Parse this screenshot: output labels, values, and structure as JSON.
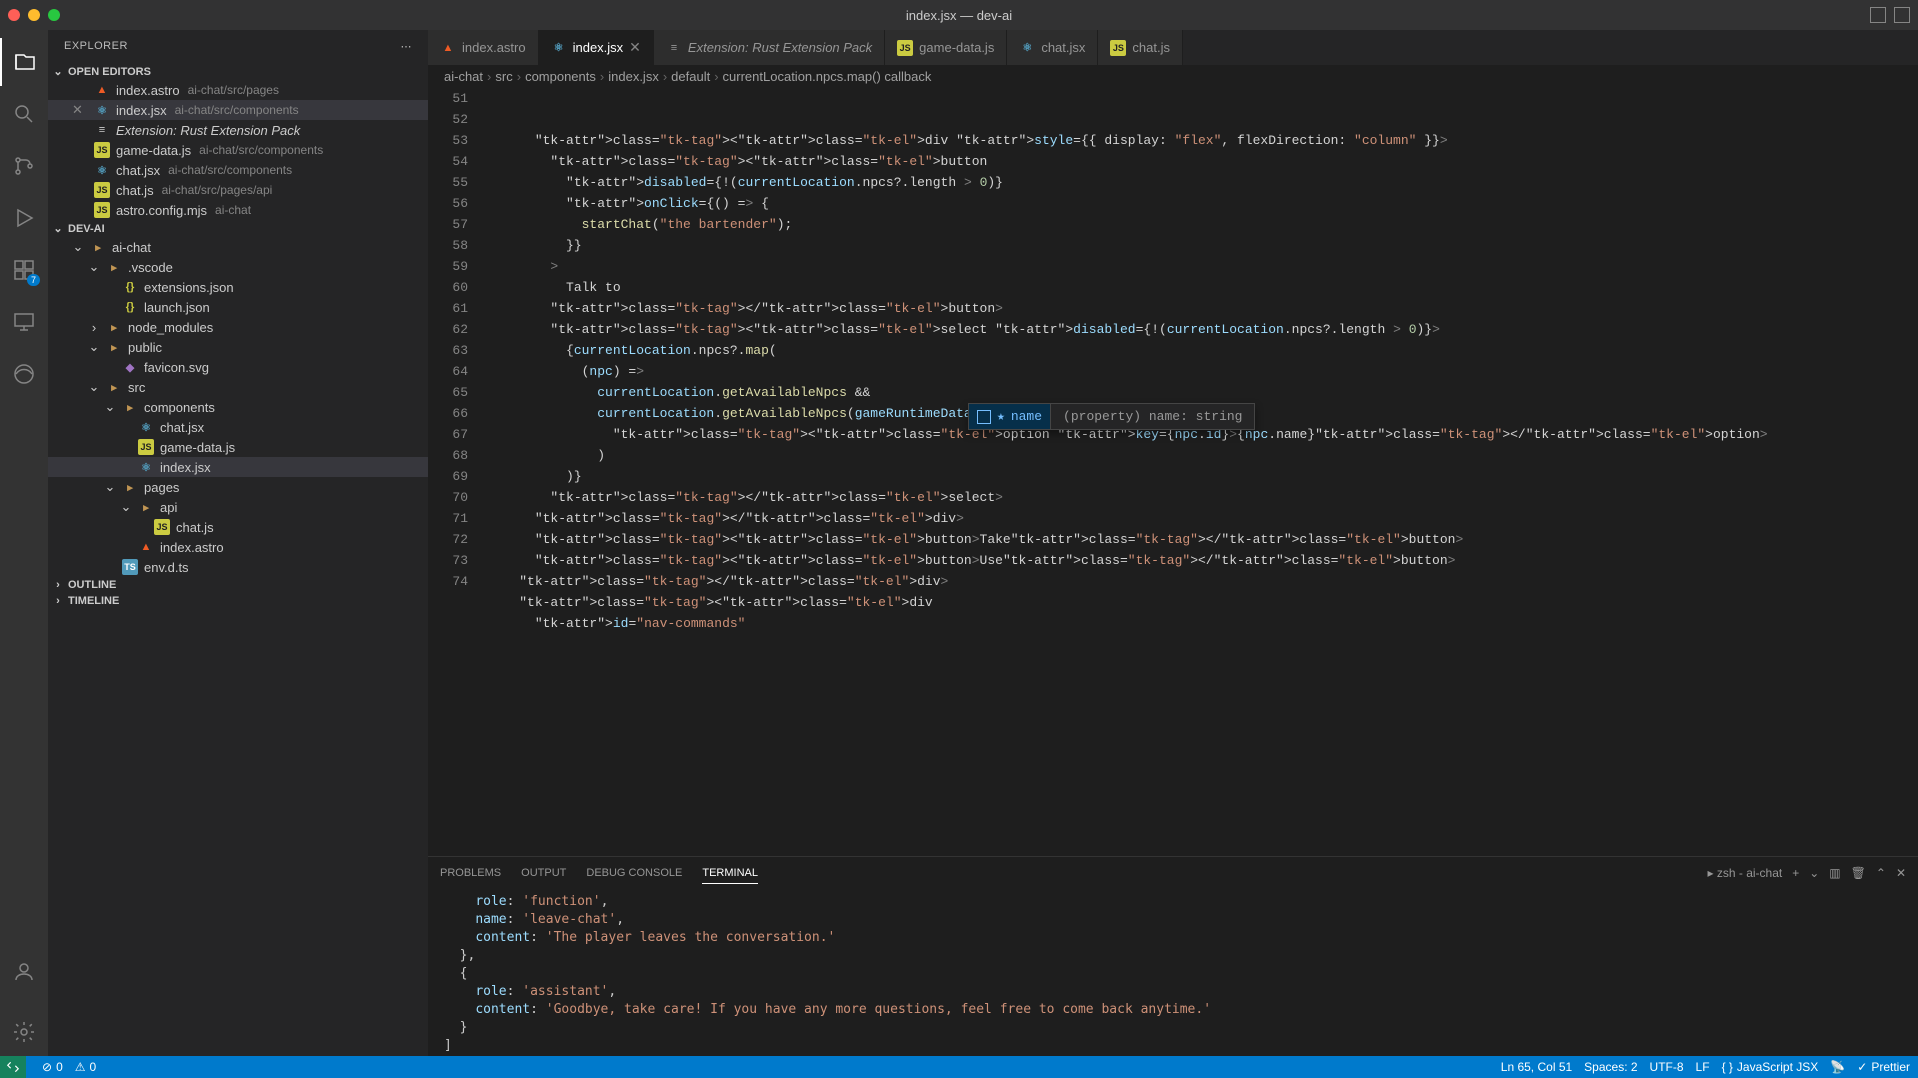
{
  "window": {
    "title": "index.jsx — dev-ai"
  },
  "explorer": {
    "header": "EXPLORER",
    "sections": {
      "openEditors": {
        "label": "OPEN EDITORS",
        "items": [
          {
            "name": "index.astro",
            "sub": "ai-chat/src/pages",
            "icon": "astro"
          },
          {
            "name": "index.jsx",
            "sub": "ai-chat/src/components",
            "icon": "jsx",
            "active": true
          },
          {
            "name": "Extension: Rust Extension Pack",
            "sub": "",
            "icon": "ext",
            "italic": true
          },
          {
            "name": "game-data.js",
            "sub": "ai-chat/src/components",
            "icon": "js"
          },
          {
            "name": "chat.jsx",
            "sub": "ai-chat/src/components",
            "icon": "jsx"
          },
          {
            "name": "chat.js",
            "sub": "ai-chat/src/pages/api",
            "icon": "js"
          },
          {
            "name": "astro.config.mjs",
            "sub": "ai-chat",
            "icon": "js"
          }
        ]
      },
      "project": {
        "label": "DEV-AI",
        "tree": [
          {
            "name": "ai-chat",
            "kind": "folder",
            "depth": 1
          },
          {
            "name": ".vscode",
            "kind": "folder",
            "depth": 2
          },
          {
            "name": "extensions.json",
            "kind": "json",
            "depth": 3
          },
          {
            "name": "launch.json",
            "kind": "json",
            "depth": 3
          },
          {
            "name": "node_modules",
            "kind": "folder",
            "depth": 2,
            "collapsed": true
          },
          {
            "name": "public",
            "kind": "folder",
            "depth": 2
          },
          {
            "name": "favicon.svg",
            "kind": "svg",
            "depth": 3
          },
          {
            "name": "src",
            "kind": "folder",
            "depth": 2
          },
          {
            "name": "components",
            "kind": "folder",
            "depth": 3
          },
          {
            "name": "chat.jsx",
            "kind": "jsx",
            "depth": 4
          },
          {
            "name": "game-data.js",
            "kind": "js",
            "depth": 4
          },
          {
            "name": "index.jsx",
            "kind": "jsx",
            "depth": 4,
            "active": true
          },
          {
            "name": "pages",
            "kind": "folder",
            "depth": 3
          },
          {
            "name": "api",
            "kind": "folder",
            "depth": 4
          },
          {
            "name": "chat.js",
            "kind": "js",
            "depth": 5
          },
          {
            "name": "index.astro",
            "kind": "astro",
            "depth": 4
          },
          {
            "name": "env.d.ts",
            "kind": "ts",
            "depth": 3
          }
        ]
      },
      "outline": {
        "label": "OUTLINE"
      },
      "timeline": {
        "label": "TIMELINE"
      }
    }
  },
  "tabs": [
    {
      "label": "index.astro",
      "icon": "astro"
    },
    {
      "label": "index.jsx",
      "icon": "jsx",
      "active": true
    },
    {
      "label": "Extension: Rust Extension Pack",
      "icon": "ext",
      "italic": true
    },
    {
      "label": "game-data.js",
      "icon": "js"
    },
    {
      "label": "chat.jsx",
      "icon": "jsx"
    },
    {
      "label": "chat.js",
      "icon": "js"
    }
  ],
  "breadcrumbs": [
    "ai-chat",
    "src",
    "components",
    "index.jsx",
    "default",
    "currentLocation.npcs.map() callback"
  ],
  "code": {
    "start": 51,
    "lines": [
      "      <div style={{ display: \"flex\", flexDirection: \"column\" }}>",
      "        <button",
      "          disabled={!(currentLocation.npcs?.length > 0)}",
      "          onClick={() => {",
      "            startChat(\"the bartender\");",
      "          }}",
      "        >",
      "          Talk to",
      "        </button>",
      "        <select disabled={!(currentLocation.npcs?.length > 0)}>",
      "          {currentLocation.npcs?.map(",
      "            (npc) =>",
      "              currentLocation.getAvailableNpcs &&",
      "              currentLocation.getAvailableNpcs(gameRuntimeData).includes(npc.id) && (",
      "                <option key={npc.id}>{npc.name}</option>",
      "              )",
      "          )}",
      "        </select>",
      "      </div>",
      "      <button>Take</button>",
      "      <button>Use</button>",
      "    </div>",
      "    <div",
      "      id=\"nav-commands\""
    ]
  },
  "suggest": {
    "item": "name",
    "detail": "(property) name: string"
  },
  "panel": {
    "tabs": [
      "PROBLEMS",
      "OUTPUT",
      "DEBUG CONSOLE",
      "TERMINAL"
    ],
    "active": 3,
    "shell": "zsh - ai-chat",
    "terminal": "    role: 'function',\n    name: 'leave-chat',\n    content: 'The player leaves the conversation.'\n  },\n  {\n    role: 'assistant',\n    content: 'Goodbye, take care! If you have any more questions, feel free to come back anytime.'\n  }\n]"
  },
  "status": {
    "errors": "0",
    "warnings": "0",
    "cursor": "Ln 65, Col 51",
    "spaces": "Spaces: 2",
    "encoding": "UTF-8",
    "eol": "LF",
    "lang": "JavaScript JSX",
    "prettier": "Prettier"
  },
  "activitybar": {
    "badge": "7"
  }
}
